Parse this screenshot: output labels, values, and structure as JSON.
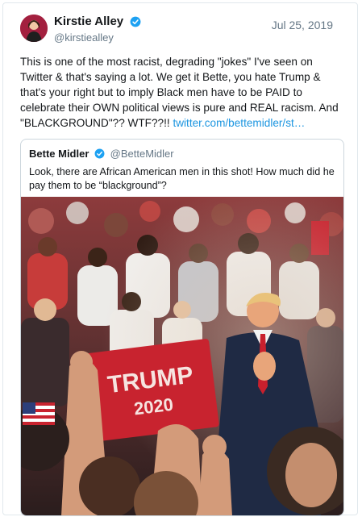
{
  "tweet": {
    "display_name": "Kirstie Alley",
    "handle": "@kirstiealley",
    "date": "Jul 25, 2019",
    "text": "This is one of the most racist, degrading \"jokes\" I've seen on Twitter & that's saying a lot. We get it Bette, you hate Trump & that's your right but to imply Black men have to be PAID to celebrate their OWN  political views is pure and REAL racism. And \"BLACKGROUND\"??  WTF??!! ",
    "link": "twitter.com/bettemidler/st…"
  },
  "quoted": {
    "display_name": "Bette Midler",
    "handle": "@BetteMidler",
    "text": "Look, there are African American men in this shot!  How much did he pay them to be “blackground”?"
  },
  "photo": {
    "sign_text": "TRUMP",
    "sign_year": "2020"
  },
  "colors": {
    "verified": "#1da1f2",
    "link": "#1b95e0",
    "sign_red": "#c8232f"
  },
  "icons": {
    "verified": "verified-badge-icon"
  }
}
